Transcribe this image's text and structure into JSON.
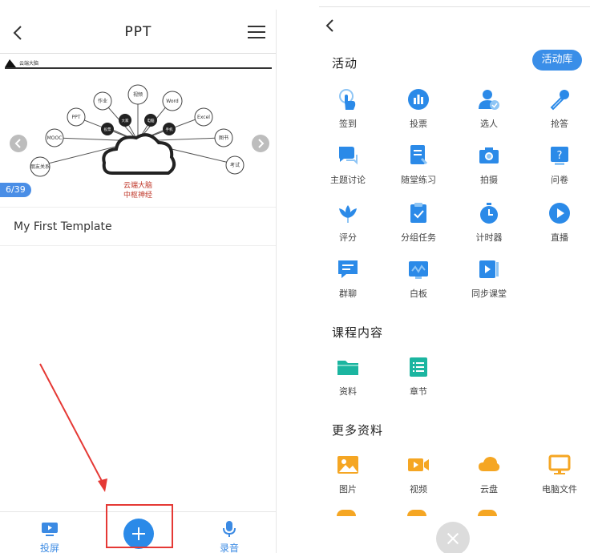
{
  "left": {
    "header": {
      "title": "PPT"
    },
    "slide": {
      "logo_text": "云端大脑",
      "page_badge": "6/39",
      "center_label_1": "云端大脑",
      "center_label_2": "中枢神经",
      "bubbles": [
        "PPT",
        "作业",
        "视频",
        "Word",
        "Excel",
        "图书",
        "考试",
        "MOOC",
        "朋友关系",
        "投票",
        "大家",
        "电脑",
        "手机"
      ]
    },
    "template_name": "My First Template",
    "bottom": {
      "screen_label": "投屏",
      "record_label": "录音"
    }
  },
  "right": {
    "sections": {
      "activity": "活动",
      "course": "课程内容",
      "more": "更多资料"
    },
    "library_button": "活动库",
    "activity_items": [
      {
        "label": "签到",
        "icon": "tap-icon"
      },
      {
        "label": "投票",
        "icon": "bar-chart-icon"
      },
      {
        "label": "选人",
        "icon": "person-check-icon"
      },
      {
        "label": "抢答",
        "icon": "microphone-icon"
      },
      {
        "label": "主题讨论",
        "icon": "chat-bubbles-icon"
      },
      {
        "label": "随堂练习",
        "icon": "quiz-doc-icon"
      },
      {
        "label": "拍摄",
        "icon": "camera-icon"
      },
      {
        "label": "问卷",
        "icon": "question-icon"
      },
      {
        "label": "评分",
        "icon": "lotus-icon"
      },
      {
        "label": "分组任务",
        "icon": "clipboard-check-icon"
      },
      {
        "label": "计时器",
        "icon": "stopwatch-icon"
      },
      {
        "label": "直播",
        "icon": "play-circle-icon"
      },
      {
        "label": "群聊",
        "icon": "group-chat-icon"
      },
      {
        "label": "白板",
        "icon": "whiteboard-icon"
      },
      {
        "label": "同步课堂",
        "icon": "sync-class-icon"
      }
    ],
    "course_items": [
      {
        "label": "资料",
        "icon": "folder-icon"
      },
      {
        "label": "章节",
        "icon": "list-icon"
      }
    ],
    "more_items": [
      {
        "label": "图片",
        "icon": "image-icon"
      },
      {
        "label": "视频",
        "icon": "video-icon"
      },
      {
        "label": "云盘",
        "icon": "cloud-icon"
      },
      {
        "label": "电脑文件",
        "icon": "monitor-icon"
      }
    ],
    "colors": {
      "accent": "#2b8ae8",
      "teal": "#1bb5a0",
      "orange": "#f5a623"
    }
  }
}
